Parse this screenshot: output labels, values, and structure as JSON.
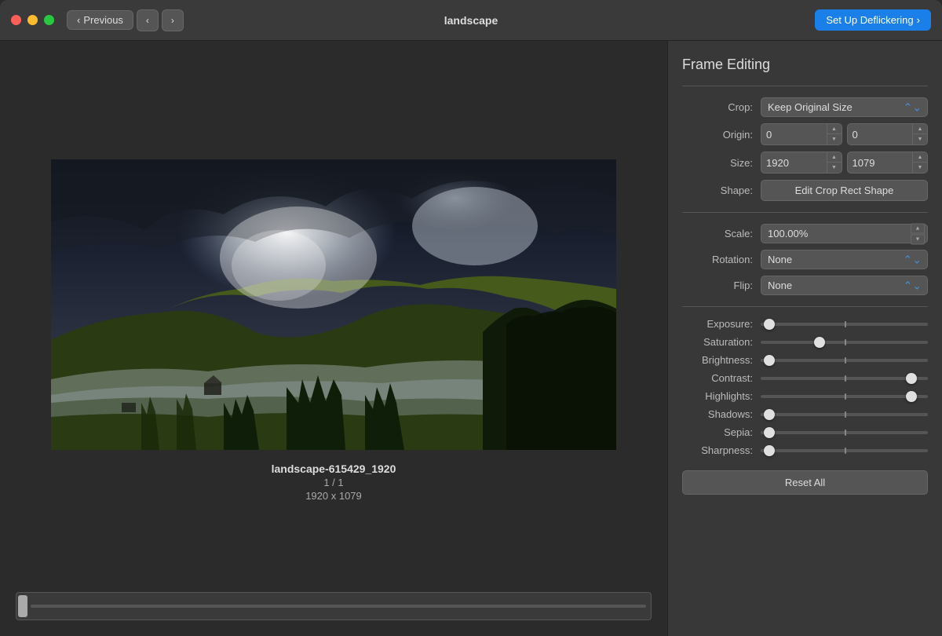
{
  "titlebar": {
    "previous_label": "Previous",
    "title": "landscape",
    "deflicker_label": "Set Up Deflickering",
    "prev_arrow": "‹",
    "left_arrow": "‹",
    "right_arrow": "›"
  },
  "image": {
    "filename": "landscape-615429_1920",
    "counter": "1 / 1",
    "dimensions": "1920 x 1079"
  },
  "panel": {
    "title": "Frame Editing",
    "crop_label": "Crop:",
    "crop_value": "Keep Original Size",
    "origin_label": "Origin:",
    "origin_x": "0",
    "origin_y": "0",
    "size_label": "Size:",
    "size_w": "1920",
    "size_h": "1079",
    "shape_label": "Shape:",
    "shape_btn": "Edit Crop Rect Shape",
    "scale_label": "Scale:",
    "scale_value": "100.00%",
    "rotation_label": "Rotation:",
    "rotation_value": "None",
    "flip_label": "Flip:",
    "flip_value": "None",
    "sliders": [
      {
        "label": "Exposure:",
        "position": 5,
        "tick": 50
      },
      {
        "label": "Saturation:",
        "position": 35,
        "tick": 50
      },
      {
        "label": "Brightness:",
        "position": 5,
        "tick": 50
      },
      {
        "label": "Contrast:",
        "position": 90,
        "tick": 50
      },
      {
        "label": "Highlights:",
        "position": 90,
        "tick": 50
      },
      {
        "label": "Shadows:",
        "position": 5,
        "tick": 50
      },
      {
        "label": "Sepia:",
        "position": 5,
        "tick": 50
      },
      {
        "label": "Sharpness:",
        "position": 5,
        "tick": 50
      }
    ],
    "reset_label": "Reset All"
  }
}
